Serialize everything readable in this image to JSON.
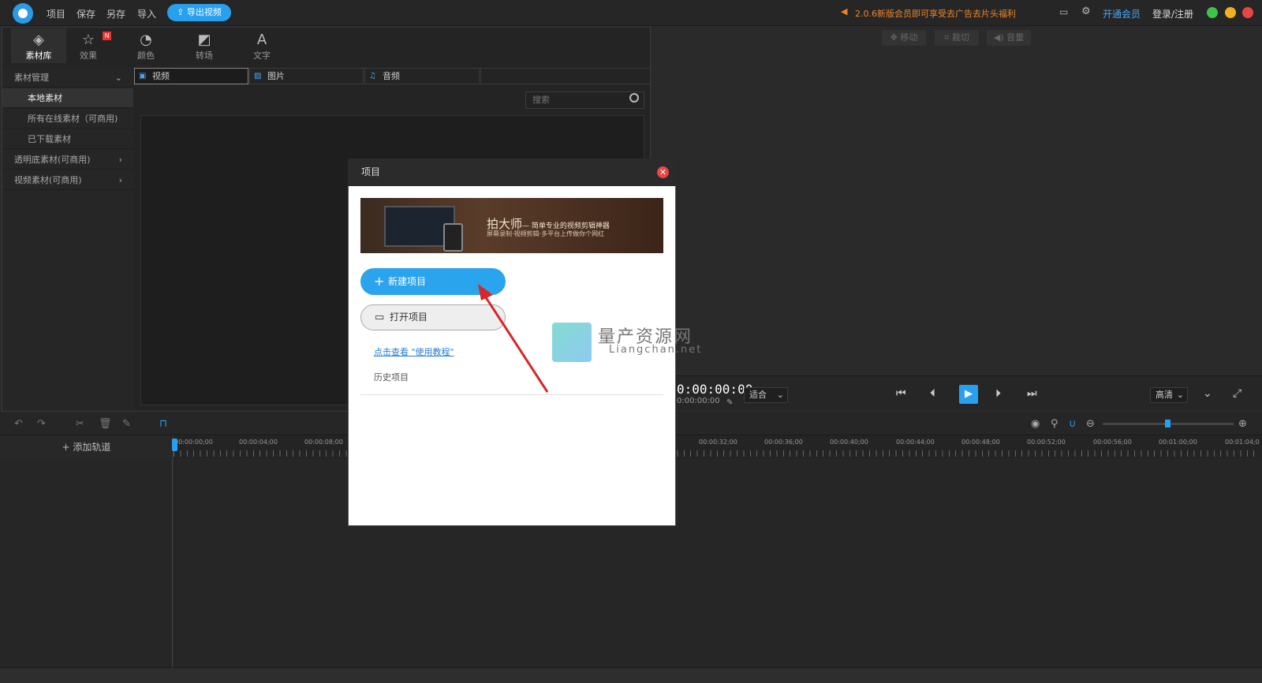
{
  "topbar": {
    "menus": [
      "项目",
      "保存",
      "另存",
      "导入"
    ],
    "export_label": "导出视频",
    "promo": "2.0.6新版会员即可享受去广告去片头福利",
    "vip": "开通会员",
    "login": "登录/注册"
  },
  "tool_tabs": [
    "素材库",
    "效果",
    "颜色",
    "转场",
    "文字"
  ],
  "tool_badge": "N",
  "categories": {
    "manage": "素材管理",
    "local": "本地素材",
    "online": "所有在线素材（可商用)",
    "downloaded": "已下载素材",
    "transparent": "透明底素材(可商用)",
    "video": "视频素材(可商用)"
  },
  "media_tabs": [
    "视频",
    "图片",
    "音频"
  ],
  "search": {
    "placeholder": "搜索"
  },
  "preview": {
    "tools": [
      "移动",
      "裁切",
      "音量"
    ],
    "timecode": "0:00:00:00",
    "timecode_sub": "0:00:00:00",
    "fit": "适合",
    "quality": "高清"
  },
  "timeline": {
    "add_track": "添加轨道",
    "ticks_left": [
      "00:00:00;00",
      "00:00:04;00",
      "00:00:08;00"
    ],
    "ticks_right": [
      "00:00:32;00",
      "00:00:36;00",
      "00:00:40;00",
      "00:00:44;00",
      "00:00:48;00",
      "00:00:52;00",
      "00:00:56;00",
      "00:01:00;00",
      "00:01:04;0"
    ]
  },
  "dialog": {
    "title": "项目",
    "banner_title": "拍大师",
    "banner_tag": "— 简单专业的视频剪辑神器",
    "banner_sub": "屏幕录制·视频剪辑·多平台上传做你个网红",
    "new_project": "新建项目",
    "open_project": "打开项目",
    "tutorial": "点击查看 \"使用教程\"",
    "history": "历史项目"
  },
  "watermark": {
    "cn": "量产资源网",
    "en": "Liangchan.net"
  },
  "colors": {
    "accent": "#27a0f0",
    "arrow": "#d8262a",
    "promo": "#f0862a"
  }
}
